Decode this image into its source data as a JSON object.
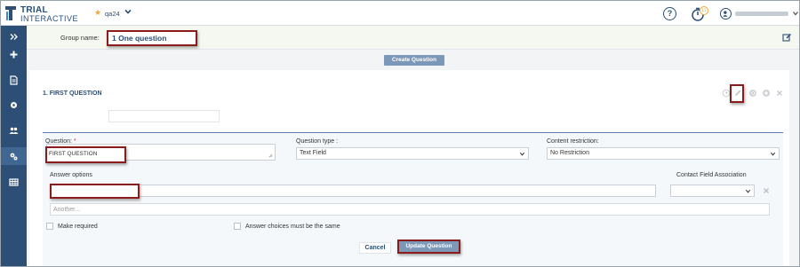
{
  "app": {
    "logo_line1": "TRIAL",
    "logo_line2": "INTERACTIVE",
    "brand_color": "#2d4e75",
    "study_name": "qa24",
    "help_label": "?",
    "timer_badge": "11"
  },
  "sidebar": {
    "items": [
      {
        "icon": "expand-chevrons-icon"
      },
      {
        "icon": "plus-icon"
      },
      {
        "icon": "document-icon"
      },
      {
        "icon": "gear-icon"
      },
      {
        "icon": "users-icon"
      },
      {
        "icon": "settings-icon",
        "active": true
      },
      {
        "icon": "table-icon"
      }
    ]
  },
  "group": {
    "label": "Group name:",
    "value": "1 One question"
  },
  "toolbar": {
    "create_label": "Create Question"
  },
  "question": {
    "title": "1. FIRST QUESTION",
    "actions": [
      "clock-icon",
      "pencil-icon",
      "arrow-icon",
      "plus-circle-icon",
      "close-icon"
    ]
  },
  "form": {
    "question_label": "Question:",
    "question_required_mark": "*",
    "question_value": "FIRST QUESTION",
    "type_label": "Question type :",
    "type_value": "Text Field",
    "restriction_label": "Content restriction:",
    "restriction_value": "No Restriction",
    "answer_label": "Answer options",
    "contact_label": "Contact Field Association",
    "another_placeholder": "Another...",
    "make_required_label": "Make required",
    "same_choices_label": "Answer choices must be the same",
    "cancel_label": "Cancel",
    "update_label": "Update Question"
  },
  "highlight_color": "#8b1c1c"
}
